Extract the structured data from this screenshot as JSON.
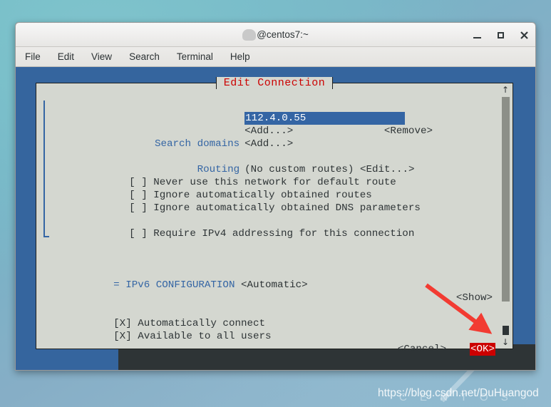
{
  "window": {
    "title": "@centos7:~",
    "title_redacted": true,
    "controls": {
      "minimize": "_",
      "maximize": "□",
      "close": "×"
    }
  },
  "menubar": {
    "items": [
      {
        "label": "File"
      },
      {
        "label": "Edit"
      },
      {
        "label": "View"
      },
      {
        "label": "Search"
      },
      {
        "label": "Terminal"
      },
      {
        "label": "Help"
      }
    ]
  },
  "dialog": {
    "title": "Edit Connection",
    "dns_servers": {
      "value": "112.4.0.55",
      "remove_label": "<Remove>",
      "add_label": "<Add...>"
    },
    "search_domains": {
      "label": "Search domains",
      "add_label": "<Add...>"
    },
    "routing": {
      "label": "Routing",
      "status": "(No custom routes)",
      "edit_label": "<Edit...>"
    },
    "checkboxes": [
      {
        "mark": "[ ]",
        "label": "Never use this network for default route",
        "checked": false
      },
      {
        "mark": "[ ]",
        "label": "Ignore automatically obtained routes",
        "checked": false
      },
      {
        "mark": "[ ]",
        "label": "Ignore automatically obtained DNS parameters",
        "checked": false
      },
      {
        "mark": "[ ]",
        "label": "Require IPv4 addressing for this connection",
        "checked": false
      }
    ],
    "ipv6": {
      "expander": "=",
      "label": "IPv6 CONFIGURATION",
      "mode": "<Automatic>",
      "show_label": "<Show>"
    },
    "options": [
      {
        "mark": "[X]",
        "label": "Automatically connect",
        "checked": true
      },
      {
        "mark": "[X]",
        "label": "Available to all users",
        "checked": true
      }
    ],
    "buttons": {
      "cancel": "<Cancel>",
      "ok": "<OK>"
    },
    "scrollbar": {
      "up_arrow": "↑",
      "down_arrow": "↓"
    }
  },
  "watermark": {
    "url": "https://blog.csdn.net/DuHuangod",
    "brand": "C E N T O S"
  },
  "colors": {
    "terminal_blue": "#35659e",
    "dialog_bg": "#d4d7d0",
    "accent_blue": "#3465a4",
    "title_red": "#cc0000",
    "ok_highlight": "#cc0000",
    "arrow_red": "#f23b32"
  }
}
